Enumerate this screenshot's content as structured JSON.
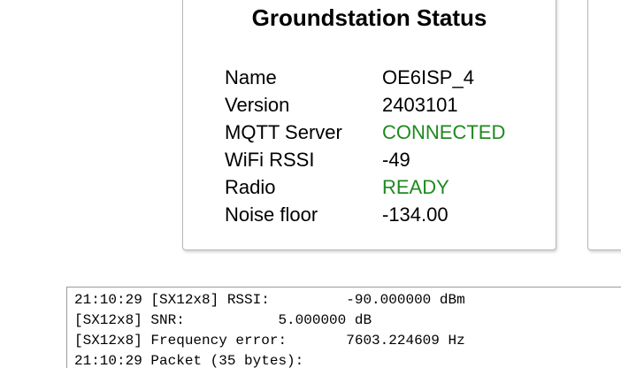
{
  "status_card": {
    "title": "Groundstation Status",
    "rows": [
      {
        "label": "Name",
        "value": "OE6ISP_4"
      },
      {
        "label": "Version",
        "value": "2403101"
      },
      {
        "label": "MQTT Server",
        "value": "CONNECTED"
      },
      {
        "label": "WiFi RSSI",
        "value": "-49"
      },
      {
        "label": "Radio",
        "value": "READY"
      },
      {
        "label": "Noise floor",
        "value": "-134.00"
      }
    ],
    "ok_color": "#1e8a1e"
  },
  "log": {
    "lines": [
      "21:10:29 [SX12x8] RSSI:         -90.000000 dBm",
      "[SX12x8] SNR:           5.000000 dB",
      "[SX12x8] Frequency error:       7603.224609 Hz",
      "21:10:29 Packet (35 bytes):"
    ]
  }
}
